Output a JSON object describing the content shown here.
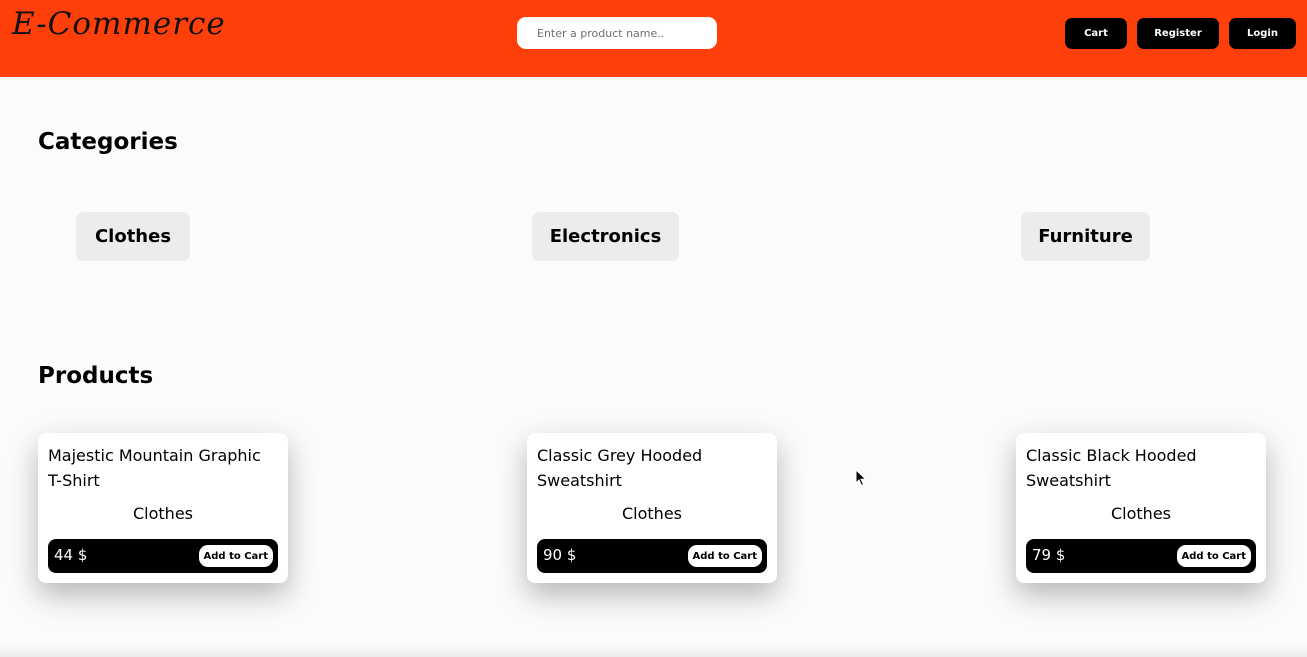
{
  "header": {
    "logo": "E-Commerce",
    "search_placeholder": "Enter a product name..",
    "buttons": {
      "cart": "Cart",
      "register": "Register",
      "login": "Login"
    }
  },
  "categories": {
    "title": "Categories",
    "items": [
      "Clothes",
      "Electronics",
      "Furniture"
    ]
  },
  "products": {
    "title": "Products",
    "items": [
      {
        "name": "Majestic Mountain Graphic T-Shirt",
        "category": "Clothes",
        "price": "44 $",
        "add_label": "Add to Cart"
      },
      {
        "name": "Classic Grey Hooded Sweatshirt",
        "category": "Clothes",
        "price": "90 $",
        "add_label": "Add to Cart"
      },
      {
        "name": "Classic Black Hooded Sweatshirt",
        "category": "Clothes",
        "price": "79 $",
        "add_label": "Add to Cart"
      }
    ]
  },
  "colors": {
    "header_bg": "#ff3f0a",
    "button_bg": "#000000",
    "category_bg": "#ececec",
    "page_bg": "#fcfbfc"
  },
  "icons": {
    "cursor": "mouse-pointer-icon"
  }
}
